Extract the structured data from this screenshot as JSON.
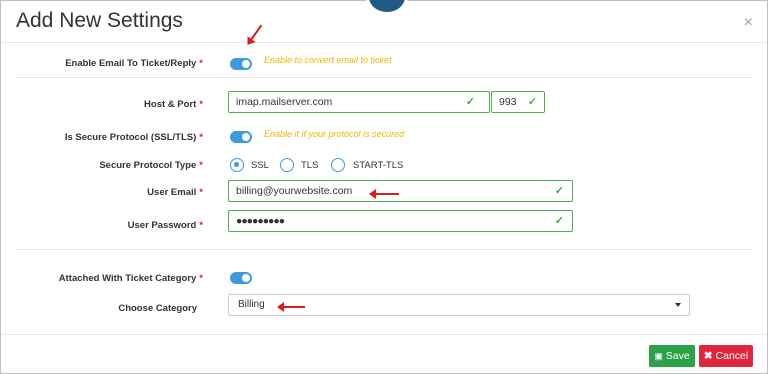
{
  "modal": {
    "title": "Add New Settings",
    "close": "×"
  },
  "form": {
    "enable_email": {
      "label": "Enable Email To Ticket/Reply",
      "required": "*",
      "hint": "Enable to convert email to ticket",
      "toggle_on": true
    },
    "host_port": {
      "label": "Host & Port",
      "required": "*",
      "host_value": "imap.mailserver.com",
      "port_value": "993"
    },
    "secure_protocol": {
      "label": "Is Secure Protocol (SSL/TLS)",
      "required": "*",
      "hint": "Enable it if your protocol is secured",
      "toggle_on": true
    },
    "protocol_type": {
      "label": "Secure Protocol Type",
      "required": "*",
      "options": [
        "SSL",
        "TLS",
        "START-TLS"
      ],
      "selected": "SSL"
    },
    "user_email": {
      "label": "User Email",
      "required": "*",
      "value": "billing@yourwebsite.com"
    },
    "user_password": {
      "label": "User Password",
      "required": "*",
      "value": "●●●●●●●●●"
    },
    "attached_category": {
      "label": "Attached With Ticket Category",
      "required": "*",
      "toggle_on": true
    },
    "choose_category": {
      "label": "Choose Category",
      "value": "Billing"
    }
  },
  "footer": {
    "save_label": "Save",
    "cancel_label": "Cancel"
  },
  "colors": {
    "accent": "#3b9bdc",
    "hint": "#f0b400",
    "valid": "#4caf50",
    "save": "#2aa146",
    "cancel": "#e0263c",
    "annotation_arrow": "#e01a1a"
  },
  "icons": {
    "close": "close-icon",
    "check": "check-icon",
    "save": "floppy-disk-icon",
    "cancel": "x-icon",
    "dropdown": "caret-down-icon"
  }
}
